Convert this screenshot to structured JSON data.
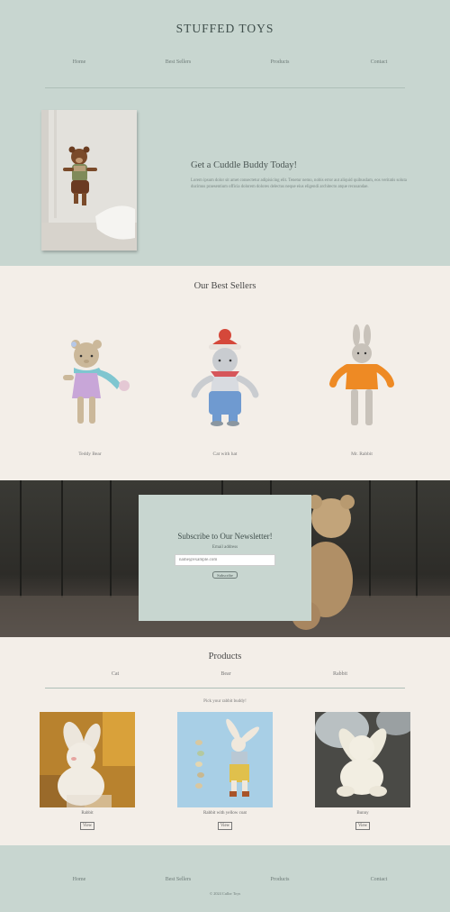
{
  "header": {
    "brand": "STUFFED TOYS",
    "nav": [
      "Home",
      "Best Sellers",
      "Products",
      "Contact"
    ]
  },
  "hero": {
    "image_icon": "bear-photo",
    "title": "Get a Cuddle Buddy Today!",
    "text": "Lorem ipsum dolor sit amet consectetur adipisicing elit. Tenetur nemo, nobis error aut aliquid quibusdam, eos veritatis soluta ducimus praesentium officia dolorem dolores delectus neque eius eligendi architecto atque recusandae."
  },
  "best_sellers": {
    "title": "Our Best Sellers",
    "items": [
      {
        "name": "Teddy Bear",
        "icon": "teddy-bear-photo"
      },
      {
        "name": "Cat with hat",
        "icon": "cat-with-hat-photo"
      },
      {
        "name": "Mr. Rabbit",
        "icon": "mr-rabbit-photo"
      }
    ]
  },
  "newsletter": {
    "title": "Subscribe to Our Newsletter!",
    "email_label": "Email address",
    "email_placeholder": "name@example.com",
    "button": "Subscribe"
  },
  "products": {
    "title": "Products",
    "tabs": [
      "Cat",
      "Bear",
      "Rabbit"
    ],
    "hint": "Pick your rabbit buddy!",
    "view_label": "View",
    "items": [
      {
        "name": "Rabbit",
        "icon": "rabbit-photo"
      },
      {
        "name": "Rabbit with yellow coat",
        "icon": "rabbit-yellow-coat-photo"
      },
      {
        "name": "Bunny",
        "icon": "bunny-photo"
      }
    ]
  },
  "footer": {
    "nav": [
      "Home",
      "Best Sellers",
      "Products",
      "Contact"
    ],
    "copyright": "© 2024 Cullor Toys"
  },
  "colors": {
    "mint": "#c8d6d0",
    "cream": "#f3eee8",
    "text_dark": "#3f4e4b"
  }
}
